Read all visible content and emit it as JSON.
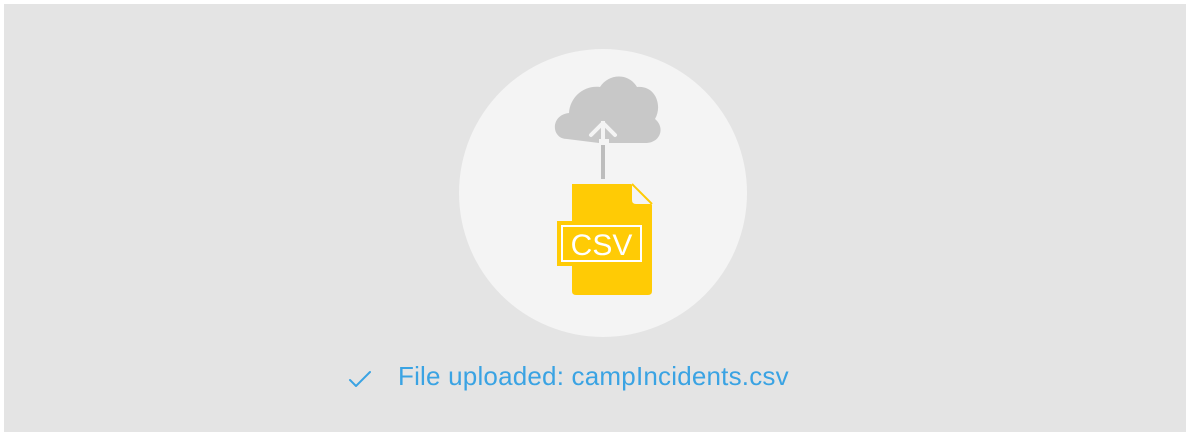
{
  "upload": {
    "file_badge_text": "CSV",
    "file_badge_icon": "csv-file-icon",
    "cloud_icon": "cloud-upload-icon",
    "status_icon": "check-icon",
    "status_text": "File uploaded: campIncidents.csv",
    "colors": {
      "panel_bg": "#e4e4e4",
      "circle_bg": "#f4f4f4",
      "cloud": "#c8c8c8",
      "file_yellow": "#ffcb05",
      "status_blue": "#3aa3e3"
    }
  }
}
